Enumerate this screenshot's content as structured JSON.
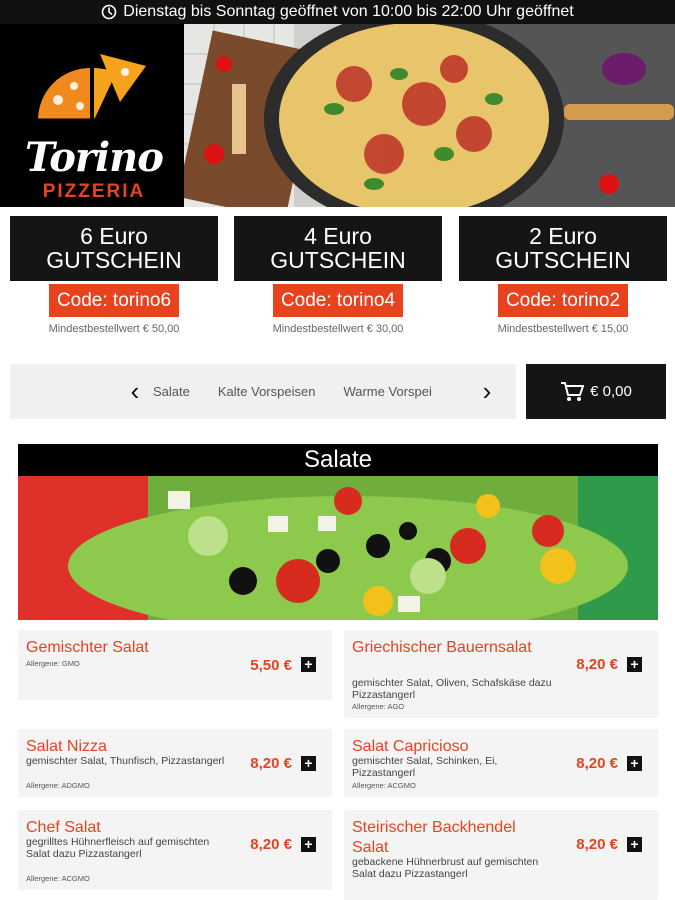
{
  "topbar": {
    "hours": "Dienstag bis Sonntag geöffnet von 10:00 bis 22:00 Uhr geöffnet"
  },
  "logo": {
    "name": "Torino",
    "sub": "PIZZERIA"
  },
  "vouchers": [
    {
      "amount": "6 Euro",
      "label": "GUTSCHEIN",
      "code": "Code: torino6",
      "min": "Mindestbestellwert € 50,00"
    },
    {
      "amount": "4 Euro",
      "label": "GUTSCHEIN",
      "code": "Code: torino4",
      "min": "Mindestbestellwert € 30,00"
    },
    {
      "amount": "2 Euro",
      "label": "GUTSCHEIN",
      "code": "Code: torino2",
      "min": "Mindestbestellwert € 15,00"
    }
  ],
  "nav": {
    "prev": "‹",
    "next": "›",
    "items": [
      "Salate",
      "Kalte Vorspeisen",
      "Warme Vorspei"
    ]
  },
  "cart": {
    "total": "€ 0,00"
  },
  "section": {
    "title": "Salate"
  },
  "menu": [
    {
      "name": "Gemischter Salat",
      "desc": "",
      "allergens": "Allergene: GMO",
      "price": "5,50 €",
      "add": "+"
    },
    {
      "name": "Griechischer Bauernsalat",
      "desc": "gemischter Salat, Oliven, Schafskäse dazu Pizzastangerl",
      "allergens": "Allergene: AGO",
      "price": "8,20 €",
      "add": "+"
    },
    {
      "name": "Salat Nizza",
      "desc": "gemischter Salat, Thunfisch, Pizzastangerl",
      "allergens": "Allergene: ADGMO",
      "price": "8,20 €",
      "add": "+"
    },
    {
      "name": "Salat Capricioso",
      "desc": "gemischter Salat, Schinken, Ei, Pizzastangerl",
      "allergens": "Allergene: ACGMO",
      "price": "8,20 €",
      "add": "+"
    },
    {
      "name": "Chef Salat",
      "desc": "gegrilltes Hühnerfleisch auf gemischten Salat dazu Pizzastangerl",
      "allergens": "Allergene: ACGMO",
      "price": "8,20 €",
      "add": "+"
    },
    {
      "name": "Steirischer Backhendel Salat",
      "desc": "gebackene Hühnerbrust auf gemischten Salat dazu Pizzastangerl",
      "allergens": "",
      "price": "8,20 €",
      "add": "+"
    }
  ],
  "colors": {
    "accent": "#e8421f",
    "dark": "#151515"
  }
}
